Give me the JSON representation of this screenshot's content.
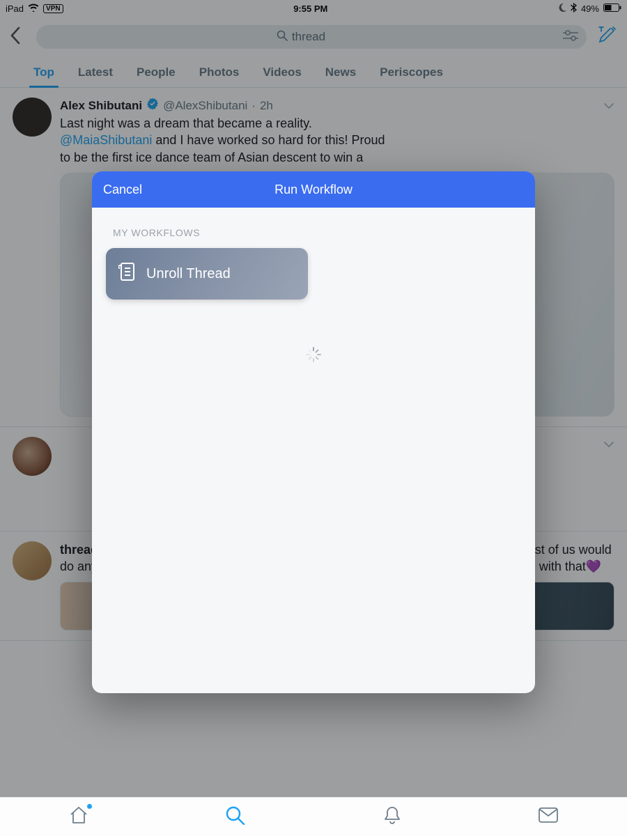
{
  "status_bar": {
    "device": "iPad",
    "vpn": "VPN",
    "time": "9:55 PM",
    "battery_pct": "49%"
  },
  "search": {
    "query": "thread"
  },
  "tabs": [
    "Top",
    "Latest",
    "People",
    "Photos",
    "Videos",
    "News",
    "Periscopes"
  ],
  "active_tab_index": 0,
  "tweets": [
    {
      "name": "Alex Shibutani",
      "verified": true,
      "handle": "@AlexShibutani",
      "age": "2h",
      "line1": "Last night was a dream that became a reality.",
      "mention": "@MaiaShibutani",
      "line2_after_mention": " and I have worked so hard for this! Proud",
      "line3": "to be the first ice dance team of Asian descent to win a"
    },
    {
      "line1_bold": "thread",
      "line1_rest": " is that she's my child and I love her as much as you love your typical child. Most of us would do anything for our kids, she just happens to need me to do a lot more... And I'm good with that",
      "heart": "💜"
    }
  ],
  "modal": {
    "cancel": "Cancel",
    "title": "Run Workflow",
    "section": "MY WORKFLOWS",
    "workflows": [
      {
        "label": "Unroll Thread"
      }
    ]
  }
}
